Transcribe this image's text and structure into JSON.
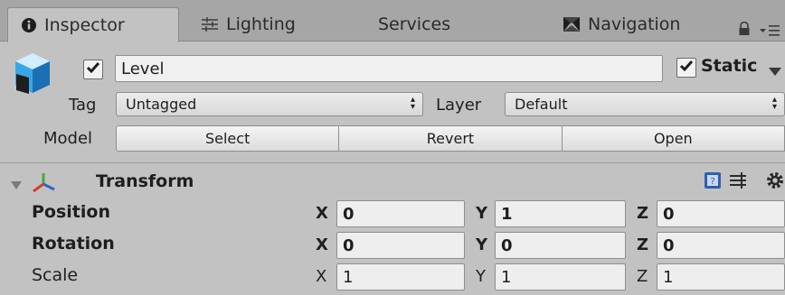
{
  "tabs": [
    {
      "label": "Inspector",
      "icon": "info-icon",
      "active": true
    },
    {
      "label": "Lighting",
      "icon": "lighting-icon",
      "active": false
    },
    {
      "label": "Services",
      "icon": "",
      "active": false
    },
    {
      "label": "Navigation",
      "icon": "navigation-icon",
      "active": false
    }
  ],
  "header": {
    "active_checked": true,
    "name": "Level",
    "static_label": "Static",
    "static_checked": true,
    "tag_label": "Tag",
    "tag_value": "Untagged",
    "layer_label": "Layer",
    "layer_value": "Default",
    "model_label": "Model",
    "model_buttons": {
      "select": "Select",
      "revert": "Revert",
      "open": "Open"
    }
  },
  "transform": {
    "title": "Transform",
    "rows": [
      {
        "label": "Position",
        "x": "0",
        "y": "1",
        "z": "0",
        "bold": true
      },
      {
        "label": "Rotation",
        "x": "0",
        "y": "0",
        "z": "0",
        "bold": true
      },
      {
        "label": "Scale",
        "x": "1",
        "y": "1",
        "z": "1",
        "bold": false
      }
    ],
    "axis_labels": {
      "x": "X",
      "y": "Y",
      "z": "Z"
    }
  },
  "colors": {
    "panel_bg": "#c2c2c2",
    "tabbar_bg": "#a6a6a6",
    "transform_axis_red": "#d63b2b",
    "transform_axis_green": "#4aa83a",
    "transform_axis_blue": "#2f66c9"
  }
}
